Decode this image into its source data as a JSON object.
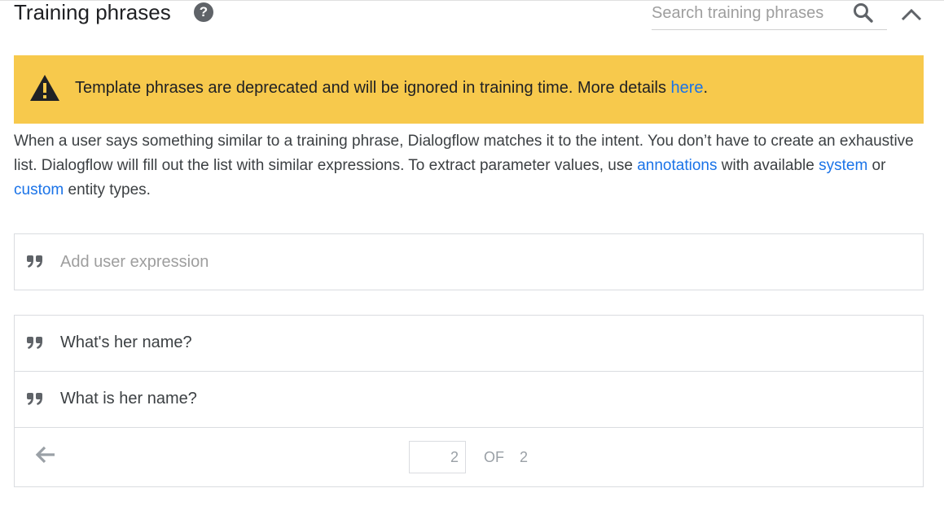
{
  "header": {
    "title": "Training phrases",
    "help_icon": "help-circle-icon",
    "search_placeholder": "Search training phrases",
    "search_icon": "search-icon",
    "collapse_icon": "chevron-up-icon"
  },
  "banner": {
    "icon": "warning-icon",
    "text_before_link": "Template phrases are deprecated and will be ignored in training time. More details ",
    "link_text": "here",
    "text_after_link": ".",
    "background_color": "#f7c94c"
  },
  "description": {
    "part1": "When a user says something similar to a training phrase, Dialogflow matches it to the intent. You don’t have to create an exhaustive list. Dialogflow will fill out the list with similar expressions. To extract parameter values, use ",
    "link_annotations": "annotations",
    "part2": " with available ",
    "link_system": "system",
    "part3": " or ",
    "link_custom": "custom",
    "part4": " entity types."
  },
  "add_expression": {
    "icon": "quote-icon",
    "placeholder": "Add user expression"
  },
  "phrases": [
    {
      "text": "What's her name?"
    },
    {
      "text": "What is her name?"
    }
  ],
  "pagination": {
    "back_icon": "arrow-left-icon",
    "current_page": "2",
    "of_label": "OF",
    "total_pages": "2"
  },
  "colors": {
    "link": "#1a73e8",
    "muted": "#9aa0a6",
    "border": "#dadce0"
  }
}
